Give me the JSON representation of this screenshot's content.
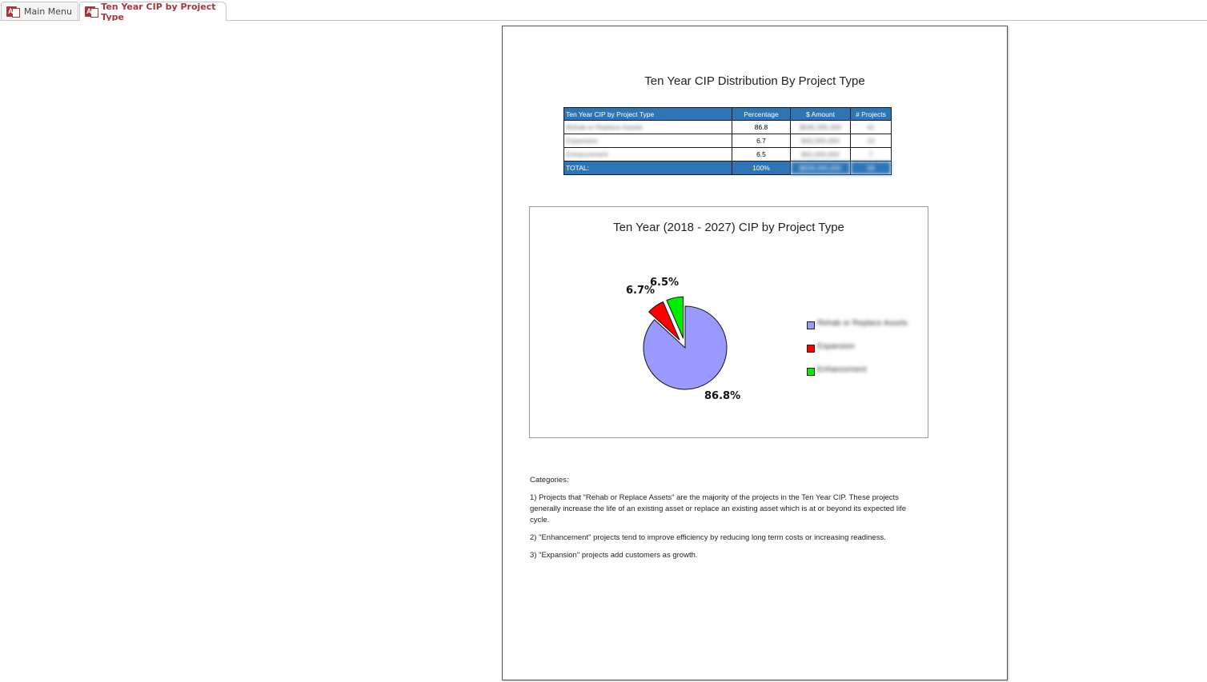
{
  "tabs": [
    {
      "label": "Main Menu",
      "active": false
    },
    {
      "label": "Ten Year CIP by Project Type",
      "active": true
    }
  ],
  "report": {
    "title": "Ten Year CIP  Distribution By Project Type",
    "table": {
      "headers": [
        "Ten Year CIP by Project Type",
        "Percentage",
        "$ Amount",
        "# Projects"
      ],
      "rows": [
        {
          "type": "Rehab or Replace Assets",
          "percentage": "86.8",
          "amount": "$545,345,000",
          "projects": "41"
        },
        {
          "type": "Expansion",
          "percentage": "6.7",
          "amount": "$42,000,000",
          "projects": "10"
        },
        {
          "type": "Enhancement",
          "percentage": "6.5",
          "amount": "$41,000,000",
          "projects": "7"
        }
      ],
      "total": {
        "label": "TOTAL:",
        "percentage": "100%",
        "amount": "$628,345,000",
        "projects": "58"
      }
    },
    "chart_title": "Ten Year (2018 - 2027) CIP by Project Type",
    "notes": {
      "heading": "Categories:",
      "items": [
        "1) Projects that \"Rehab or Replace Assets\" are the majority of the projects in the Ten Year CIP. These projects generally increase the life of an existing asset or replace an existing asset which is at or beyond its expected life cycle.",
        "2) \"Enhancement\" projects tend to improve efficiency by reducing long term costs or increasing readiness.",
        "3) \"Expansion\" projects add customers as growth."
      ]
    }
  },
  "chart_data": {
    "type": "pie",
    "title": "Ten Year (2018 - 2027) CIP by Project Type",
    "labels": [
      "Rehab or Replace Assets",
      "Expansion",
      "Enhancement"
    ],
    "values": [
      86.8,
      6.7,
      6.5
    ],
    "data_labels": [
      "86.8%",
      "6.7%",
      "6.5%"
    ],
    "colors": [
      "#9999ff",
      "#ff0000",
      "#00ee00"
    ],
    "legend_position": "right"
  }
}
